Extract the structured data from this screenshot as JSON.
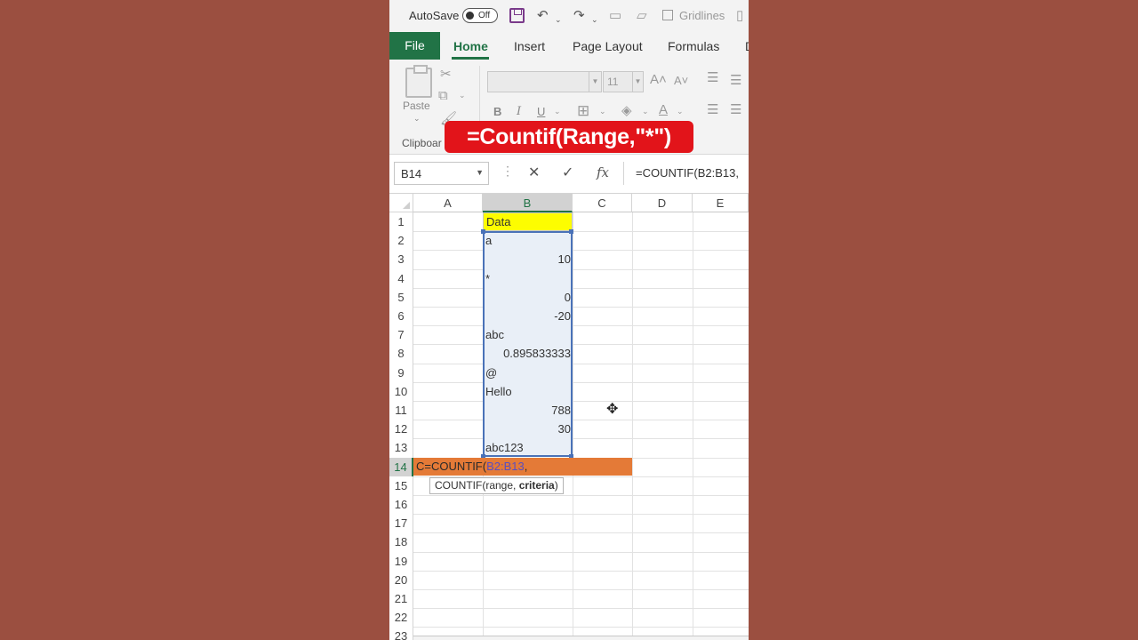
{
  "quick_access": {
    "autosave_label": "AutoSave",
    "autosave_state": "Off",
    "gridlines_label": "Gridlines"
  },
  "tabs": [
    "File",
    "Home",
    "Insert",
    "Page Layout",
    "Formulas",
    "D"
  ],
  "ribbon": {
    "paste_label": "Paste",
    "clipboard_group": "Clipboar",
    "font_name": "",
    "font_size": "11",
    "bold": "B",
    "italic": "I",
    "underline": "U"
  },
  "overlay_banner": "=Countif(Range,\"*\")",
  "formula_bar": {
    "name_box": "B14",
    "fx": "fx",
    "content": "=COUNTIF(B2:B13,"
  },
  "sheet": {
    "columns": [
      "A",
      "B",
      "C",
      "D",
      "E"
    ],
    "selected_column": "B",
    "rows": [
      "1",
      "2",
      "3",
      "4",
      "5",
      "6",
      "7",
      "8",
      "9",
      "10",
      "11",
      "12",
      "13",
      "14",
      "15",
      "16",
      "17",
      "18",
      "19",
      "20",
      "21",
      "22",
      "23"
    ],
    "selected_row": "14",
    "column_b": [
      {
        "row": 1,
        "value": "Data",
        "align": "left"
      },
      {
        "row": 2,
        "value": "a",
        "align": "left"
      },
      {
        "row": 3,
        "value": "10",
        "align": "right"
      },
      {
        "row": 4,
        "value": "*",
        "align": "left"
      },
      {
        "row": 5,
        "value": "0",
        "align": "right"
      },
      {
        "row": 6,
        "value": "-20",
        "align": "right"
      },
      {
        "row": 7,
        "value": "abc",
        "align": "left"
      },
      {
        "row": 8,
        "value": "0.895833333",
        "align": "right"
      },
      {
        "row": 9,
        "value": "@",
        "align": "left"
      },
      {
        "row": 10,
        "value": "Hello",
        "align": "left"
      },
      {
        "row": 11,
        "value": "788",
        "align": "right"
      },
      {
        "row": 12,
        "value": "30",
        "align": "right"
      },
      {
        "row": 13,
        "value": "abc123",
        "align": "left"
      }
    ],
    "edit_cell": {
      "prefix": "C=COUNTIF(",
      "range_ref": "B2:B13",
      "suffix": ","
    },
    "tooltip": {
      "func": "COUNTIF(",
      "arg1": "range, ",
      "arg2": "criteria",
      "close": ")"
    }
  },
  "colors": {
    "excel_green": "#217346",
    "header_fill": "#fdfd00",
    "edit_row_fill": "#e47a37",
    "range_border": "#4a72b8",
    "banner_red": "#e2141a"
  }
}
